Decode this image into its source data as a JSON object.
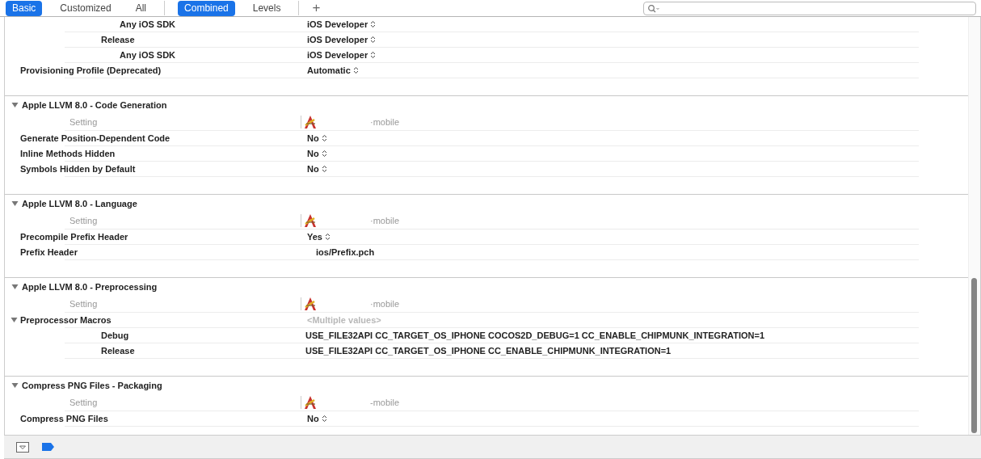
{
  "toolbar": {
    "scope_tabs": [
      {
        "label": "Basic",
        "selected": true
      },
      {
        "label": "Customized",
        "selected": false
      },
      {
        "label": "All",
        "selected": false
      }
    ],
    "view_tabs": [
      {
        "label": "Combined",
        "selected": true
      },
      {
        "label": "Levels",
        "selected": false
      }
    ],
    "add_button": "+"
  },
  "top_rows": [
    {
      "children": [
        {
          "children": [
            {
              "label": "Any iOS SDK",
              "value": "iOS Developer",
              "kind": "popup"
            }
          ]
        },
        {
          "label": "Release",
          "value": "iOS Developer",
          "kind": "popup",
          "children": [
            {
              "label": "Any iOS SDK",
              "value": "iOS Developer",
              "kind": "popup"
            }
          ]
        }
      ]
    },
    {
      "label": "Provisioning Profile (Deprecated)",
      "value": "Automatic",
      "kind": "popup"
    }
  ],
  "sections": [
    {
      "title": "Apple LLVM 8.0 - Code Generation",
      "expanded": true,
      "header": {
        "setting": "Setting",
        "target": "·mobile"
      },
      "rows": [
        {
          "label": "Generate Position-Dependent Code",
          "value": "No",
          "kind": "popup"
        },
        {
          "label": "Inline Methods Hidden",
          "value": "No",
          "kind": "popup"
        },
        {
          "label": "Symbols Hidden by Default",
          "value": "No",
          "kind": "popup"
        }
      ]
    },
    {
      "title": "Apple LLVM 8.0 - Language",
      "expanded": true,
      "header": {
        "setting": "Setting",
        "target": "·mobile"
      },
      "rows": [
        {
          "label": "Precompile Prefix Header",
          "value": "Yes",
          "kind": "popup"
        },
        {
          "label": "Prefix Header",
          "value": "ios/Prefix.pch",
          "kind": "field"
        }
      ]
    },
    {
      "title": "Apple LLVM 8.0 - Preprocessing",
      "expanded": true,
      "header": {
        "setting": "Setting",
        "target": "·mobile"
      },
      "rows": [
        {
          "label": "Preprocessor Macros",
          "value": "<Multiple values>",
          "kind": "placeholder",
          "expanded": true,
          "children": [
            {
              "label": "Debug",
              "value": "USE_FILE32API CC_TARGET_OS_IPHONE COCOS2D_DEBUG=1 CC_ENABLE_CHIPMUNK_INTEGRATION=1",
              "kind": "text"
            },
            {
              "label": "Release",
              "value": "USE_FILE32API CC_TARGET_OS_IPHONE CC_ENABLE_CHIPMUNK_INTEGRATION=1",
              "kind": "text"
            }
          ]
        }
      ]
    },
    {
      "title": "Compress PNG Files - Packaging",
      "expanded": true,
      "header": {
        "setting": "Setting",
        "target": "-mobile"
      },
      "rows": [
        {
          "label": "Compress PNG Files",
          "value": "No",
          "kind": "popup"
        }
      ]
    }
  ]
}
